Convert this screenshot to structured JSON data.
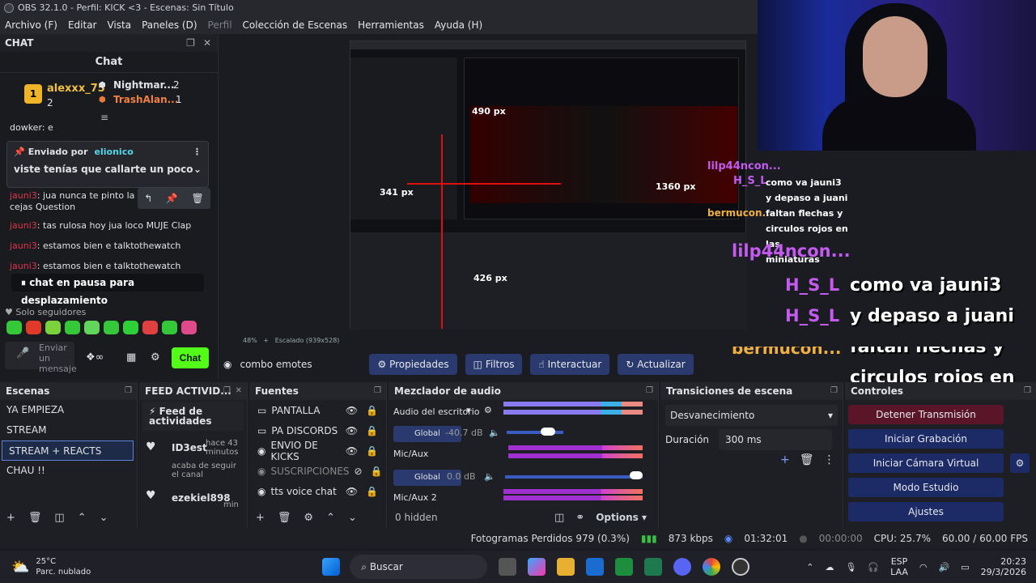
{
  "window": {
    "title": "OBS 32.1.0 - Perfil: KICK <3 - Escenas: Sin Título"
  },
  "menu": {
    "items": [
      "Archivo (F)",
      "Editar",
      "Vista",
      "Paneles (D)",
      "Perfil",
      "Colección de Escenas",
      "Herramientas",
      "Ayuda (H)"
    ]
  },
  "chat": {
    "dock_title": "CHAT",
    "header": "Chat",
    "leaders": [
      {
        "name": "alexxx_75",
        "count": "2"
      },
      {
        "name": "Nightmar...",
        "count": "2"
      },
      {
        "name": "TrashAlan...",
        "count": "1"
      }
    ],
    "partial_line": "dowker: e",
    "pinned": {
      "label": "Enviado por",
      "user": "elionico",
      "text": "viste tenías que callarte un poco"
    },
    "messages": [
      {
        "user": "jauni3",
        "text": ": jua nunca te pinto la de hace",
        "cont": "cejas Question"
      },
      {
        "user": "jauni3",
        "text": ": tas rulosa hoy jua loco MUJE Clap"
      },
      {
        "user": "jauni3",
        "text": ": estamos bien e talktothewatch"
      },
      {
        "user": "jauni3",
        "text": ": estamos bien e talktothewatch"
      }
    ],
    "pause": "chat en pausa para desplazamiento",
    "followers": "Solo seguidores",
    "input_placeholder": "Enviar un mensaje",
    "send": "Chat",
    "emote_colors": [
      "#35c93a",
      "#e03a2b",
      "#7ad33c",
      "#35c93a",
      "#62d65a",
      "#35c93a",
      "#2fcf3a",
      "#e04040",
      "#35c93a",
      "#e04a8a"
    ]
  },
  "overlay": {
    "lines": [
      "como va jauni3",
      "y depaso a juani",
      "faltan flechas y",
      "circulos rojos en las",
      "miniaturas"
    ],
    "users": [
      "lilp44ncon...",
      "H_S_L",
      "H_S_L",
      "bermucon..."
    ],
    "small_users": [
      "lilp44ncon...",
      "H_S_L",
      "bermucon..."
    ],
    "small_lines": [
      "como va jauni3",
      "y depaso a juani",
      "faltan flechas y",
      "circulos rojos en las",
      "miniaturas"
    ],
    "annotations": [
      "490 px",
      "341 px",
      "426 px",
      "1360 px"
    ]
  },
  "preview_status": {
    "zoom": "48%",
    "scale": "Escalado (939x528)"
  },
  "context": {
    "source": "combo emotes",
    "buttons": [
      "Propiedades",
      "Filtros",
      "Interactuar",
      "Actualizar"
    ]
  },
  "scenes": {
    "title": "Escenas",
    "items": [
      "YA EMPIEZA",
      "STREAM",
      "STREAM + REACTS",
      "CHAU !!"
    ],
    "selected": 2
  },
  "feed": {
    "title": "FEED ACTIVID...",
    "header": "Feed de actividades",
    "items": [
      {
        "user": "ID3est",
        "time": "hace 43 minutos",
        "text": "acaba de seguir el canal"
      },
      {
        "user": "ezekiel898",
        "time": "min"
      }
    ]
  },
  "sources": {
    "title": "Fuentes",
    "items": [
      "PANTALLA",
      "PA DISCORDS",
      "ENVIO DE KICKS",
      "SUSCRIPCIONES",
      "tts voice chat"
    ]
  },
  "mixer": {
    "title": "Mezclador de audio",
    "channels": [
      {
        "name": "Audio del escritorio",
        "db": "-40.7 dB",
        "level": 0.3
      },
      {
        "name": "Mic/Aux",
        "db": "0.0 dB",
        "level": 1.0
      },
      {
        "name": "Mic/Aux 2",
        "db": "",
        "level": 0
      }
    ],
    "global": "Global",
    "hidden": "0 hidden",
    "options": "Options",
    "scale": [
      "-60",
      "-54",
      "-48",
      "-42",
      "-36",
      "-30",
      "-24",
      "-18",
      "-12",
      "-6",
      "0"
    ]
  },
  "transitions": {
    "title": "Transiciones de escena",
    "type": "Desvanecimiento",
    "duration_label": "Duración",
    "duration": "300 ms"
  },
  "controls": {
    "title": "Controles",
    "buttons": [
      "Detener Transmisión",
      "Iniciar Grabación",
      "Iniciar Cámara Virtual",
      "Modo Estudio",
      "Ajustes"
    ]
  },
  "status": {
    "frames": "Fotogramas Perdidos 979 (0.3%)",
    "kbps": "873 kbps",
    "stream_time": "01:32:01",
    "rec_time": "00:00:00",
    "cpu": "CPU: 25.7%",
    "fps": "60.00 / 60.00 FPS"
  },
  "taskbar": {
    "weather": "25°C",
    "weather_desc": "Parc. nublado",
    "search": "Buscar",
    "lang1": "ESP",
    "lang2": "LAA",
    "time": "20:23",
    "date": "29/3/2026"
  }
}
